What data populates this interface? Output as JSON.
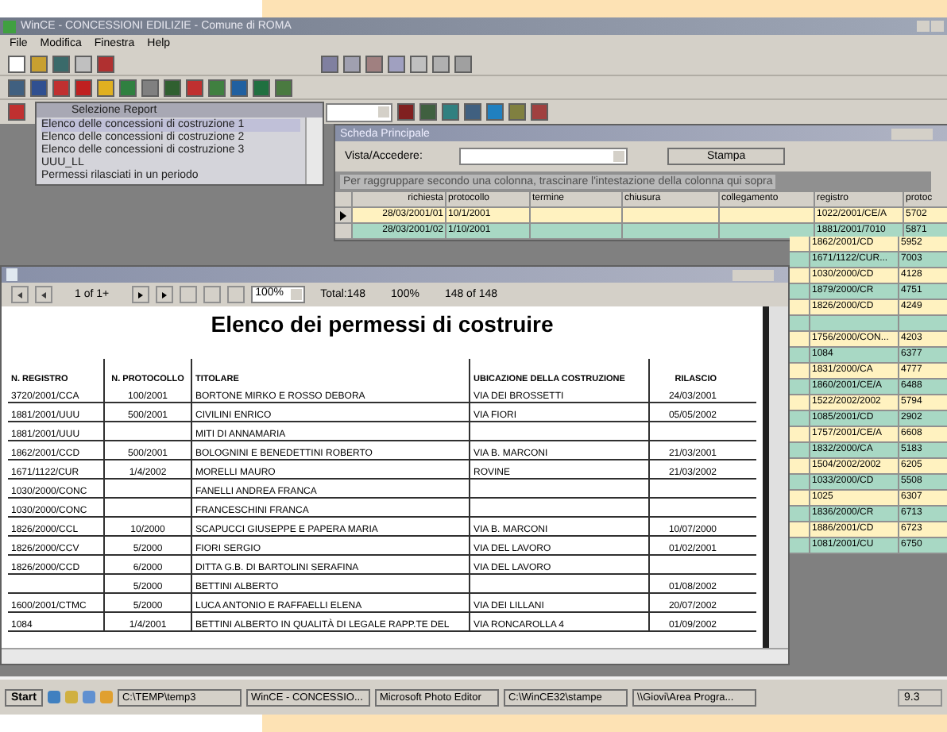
{
  "window": {
    "title": "WinCE - CONCESSIONI EDILIZIE - Comune di ROMA"
  },
  "menu": [
    "File",
    "Modifica",
    "Finestra",
    "Help"
  ],
  "report_picker": {
    "title": "Selezione Report",
    "items": [
      {
        "label": "Elenco delle concessioni di costruzione 1",
        "selected": true
      },
      {
        "label": "Elenco delle concessioni di costruzione 2",
        "selected": false
      },
      {
        "label": "Elenco delle concessioni di costruzione 3",
        "selected": false
      },
      {
        "label": "UUU_LL",
        "selected": false
      },
      {
        "label": "Permessi rilasciati in un periodo",
        "selected": false
      }
    ]
  },
  "main_form": {
    "title": "Scheda Principale",
    "field_label": "Vista/Accedere:",
    "button": "Stampa",
    "group_hint": "Per raggruppare secondo una colonna, trascinare l'intestazione della colonna qui sopra",
    "columns": [
      "richiesta",
      "protocollo",
      "termine",
      "chiusura",
      "collegamento",
      "registro",
      "protoc"
    ],
    "rows": [
      {
        "selected": true,
        "cells": [
          "28/03/2001/01",
          "10/1/2001",
          "",
          "",
          "",
          "1022/2001/CE/A",
          "5702"
        ]
      },
      {
        "selected": false,
        "cells": [
          "28/03/2001/02",
          "1/10/2001",
          "",
          "",
          "",
          "1881/2001/7010",
          "5871"
        ]
      }
    ],
    "more_rows": [
      {
        "registro": "1862/2001/CD",
        "protocollo": "5952"
      },
      {
        "registro": "1671/1122/CUR...",
        "protocollo": "7003"
      },
      {
        "registro": "1030/2000/CD",
        "protocollo": "4128"
      },
      {
        "registro": "1879/2000/CR",
        "protocollo": "4751"
      },
      {
        "registro": "1826/2000/CD",
        "protocollo": "4249"
      },
      {
        "registro": "",
        "protocollo": ""
      },
      {
        "registro": "1756/2000/CON...",
        "protocollo": "4203"
      },
      {
        "registro": "1084",
        "protocollo": "6377"
      },
      {
        "registro": "1831/2000/CA",
        "protocollo": "4777"
      },
      {
        "registro": "1860/2001/CE/A",
        "protocollo": "6488"
      },
      {
        "registro": "1522/2002/2002",
        "protocollo": "5794"
      },
      {
        "registro": "1085/2001/CD",
        "protocollo": "2902"
      },
      {
        "registro": "1757/2001/CE/A",
        "protocollo": "6608"
      },
      {
        "registro": "1832/2000/CA",
        "protocollo": "5183"
      },
      {
        "registro": "1504/2002/2002",
        "protocollo": "6205"
      },
      {
        "registro": "1033/2000/CD",
        "protocollo": "5508"
      },
      {
        "registro": "1025",
        "protocollo": "6307"
      },
      {
        "registro": "1836/2000/CR",
        "protocollo": "6713"
      },
      {
        "registro": "1886/2001/CD",
        "protocollo": "6723"
      },
      {
        "registro": "1081/2001/CU",
        "protocollo": "6750"
      }
    ]
  },
  "report_viewer": {
    "page": "1 of 1+",
    "zoom": "100%",
    "total": "Total:148",
    "percent": "100%",
    "count": "148 of 148",
    "title": "Elenco dei permessi di costruire",
    "columns": [
      "N. REGISTRO",
      "N. PROTOCOLLO",
      "TITOLARE",
      "UBICAZIONE DELLA COSTRUZIONE",
      "RILASCIO"
    ],
    "rows": [
      [
        "3720/2001/CCA",
        "100/2001",
        "BORTONE MIRKO E ROSSO DEBORA",
        "VIA DEI BROSSETTI",
        "24/03/2001"
      ],
      [
        "1881/2001/UUU",
        "500/2001",
        "CIVILINI ENRICO",
        "VIA FIORI",
        "05/05/2002"
      ],
      [
        "1881/2001/UUU",
        "",
        "MITI DI ANNAMARIA",
        "",
        ""
      ],
      [
        "1862/2001/CCD",
        "500/2001",
        "BOLOGNINI E BENEDETTINI ROBERTO",
        "VIA B. MARCONI",
        "21/03/2001"
      ],
      [
        "1671/1122/CUR",
        "1/4/2002",
        "MORELLI MAURO",
        "ROVINE",
        "21/03/2002"
      ],
      [
        "1030/2000/CONC",
        "",
        "FANELLI ANDREA FRANCA",
        "",
        ""
      ],
      [
        "1030/2000/CONC",
        "",
        "FRANCESCHINI FRANCA",
        "",
        ""
      ],
      [
        "1826/2000/CCL",
        "10/2000",
        "SCAPUCCI GIUSEPPE E PAPERA MARIA",
        "VIA B. MARCONI",
        "10/07/2000"
      ],
      [
        "1826/2000/CCV",
        "5/2000",
        "FIORI SERGIO",
        "VIA DEL LAVORO",
        "01/02/2001"
      ],
      [
        "1826/2000/CCD",
        "6/2000",
        "DITTA G.B. DI BARTOLINI SERAFINA",
        "VIA DEL LAVORO",
        ""
      ],
      [
        "",
        "5/2000",
        "BETTINI ALBERTO",
        "",
        "01/08/2002"
      ],
      [
        "1600/2001/CTMC",
        "5/2000",
        "LUCA ANTONIO E RAFFAELLI ELENA",
        "VIA DEI LILLANI",
        "20/07/2002"
      ],
      [
        "1084",
        "1/4/2001",
        "BETTINI ALBERTO IN QUALITÀ DI LEGALE RAPP.TE DEL",
        "VIA RONCAROLLA 4",
        "01/09/2002"
      ]
    ]
  },
  "taskbar": {
    "start": "Start",
    "tasks": [
      "C:\\TEMP\\temp3",
      "WinCE - CONCESSIO...",
      "Microsoft Photo Editor",
      "C:\\WinCE32\\stampe",
      "\\\\Giovi\\Area Progra..."
    ],
    "clock": "9.3"
  }
}
